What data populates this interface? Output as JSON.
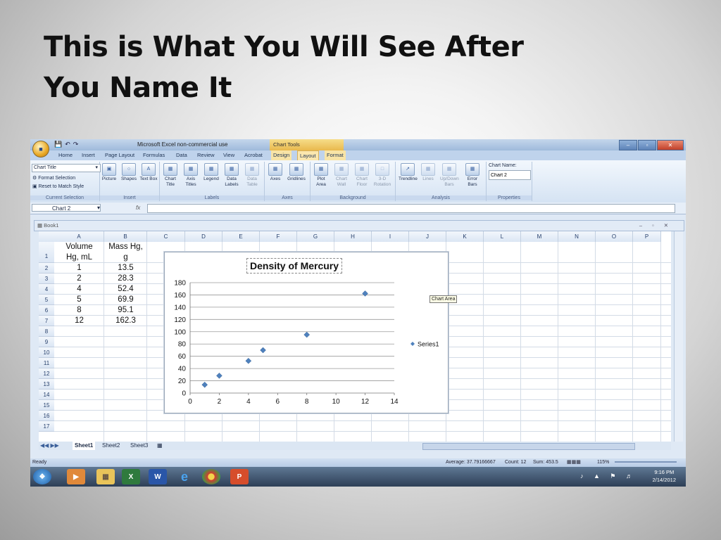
{
  "slide": {
    "title_line1": "This is What You Will See After",
    "title_line2": "You Name It"
  },
  "excel": {
    "window_title": "Microsoft Excel non-commercial use",
    "context_tab_header": "Chart Tools",
    "office_button": "",
    "window_controls": [
      "–",
      "▫",
      "✕"
    ],
    "tabs": [
      "Home",
      "Insert",
      "Page Layout",
      "Formulas",
      "Data",
      "Review",
      "View",
      "Acrobat",
      "Design",
      "Layout",
      "Format"
    ],
    "active_tab": "Layout",
    "ribbon": {
      "current_selection": {
        "dropdown": "Chart Title",
        "format_selection": "Format Selection",
        "reset_style": "Reset to Match Style",
        "label": "Current Selection"
      },
      "insert": {
        "buttons": [
          "Picture",
          "Shapes",
          "Text Box"
        ],
        "label": "Insert"
      },
      "labels": {
        "buttons": [
          "Chart Title",
          "Axis Titles",
          "Legend",
          "Data Labels",
          "Data Table"
        ],
        "label": "Labels"
      },
      "axes": {
        "buttons": [
          "Axes",
          "Gridlines"
        ],
        "label": "Axes"
      },
      "background": {
        "buttons": [
          "Plot Area",
          "Chart Wall",
          "Chart Floor",
          "3-D Rotation"
        ],
        "label": "Background"
      },
      "analysis": {
        "buttons": [
          "Trendline",
          "Lines",
          "Up/Down Bars",
          "Error Bars"
        ],
        "label": "Analysis"
      },
      "properties": {
        "chart_name_label": "Chart Name:",
        "chart_name_value": "Chart 2",
        "label": "Properties"
      }
    },
    "name_box": "Chart 2",
    "fx": "fx",
    "workbook_title": "Book1",
    "columns": [
      "A",
      "B",
      "C",
      "D",
      "E",
      "F",
      "G",
      "H",
      "I",
      "J",
      "K",
      "L",
      "M",
      "N",
      "O",
      "P"
    ],
    "rows": [
      "1",
      "2",
      "3",
      "4",
      "5",
      "6",
      "7",
      "8",
      "9",
      "10",
      "11",
      "12",
      "13",
      "14",
      "15",
      "16",
      "17"
    ],
    "header_a": [
      "Volume",
      "Hg, mL"
    ],
    "header_b": [
      "Mass Hg,",
      "g"
    ],
    "col_a": [
      "1",
      "2",
      "4",
      "5",
      "8",
      "12"
    ],
    "col_b": [
      "13.5",
      "28.3",
      "52.4",
      "69.9",
      "95.1",
      "162.3"
    ],
    "sheet_tabs": [
      "Sheet1",
      "Sheet2",
      "Sheet3"
    ],
    "chart_area_tooltip": "Chart Area",
    "status": {
      "ready": "Ready",
      "average": "Average: 37.79166667",
      "count": "Count: 12",
      "sum": "Sum: 453.5",
      "zoom": "115%"
    },
    "taskbar": {
      "time": "9:16 PM",
      "date": "2/14/2012"
    }
  },
  "chart_data": {
    "type": "scatter",
    "title": "Density of Mercury",
    "xlabel": "",
    "ylabel": "",
    "xlim": [
      0,
      14
    ],
    "ylim": [
      0,
      180
    ],
    "xticks": [
      0,
      2,
      4,
      6,
      8,
      10,
      12,
      14
    ],
    "yticks": [
      0,
      20,
      40,
      60,
      80,
      100,
      120,
      140,
      160,
      180
    ],
    "grid": "horizontal",
    "legend": "right",
    "series": [
      {
        "name": "Series1",
        "color": "#4f81bd",
        "x": [
          1,
          2,
          4,
          5,
          8,
          12
        ],
        "y": [
          13.5,
          28.3,
          52.4,
          69.9,
          95.1,
          162.3
        ]
      }
    ]
  }
}
